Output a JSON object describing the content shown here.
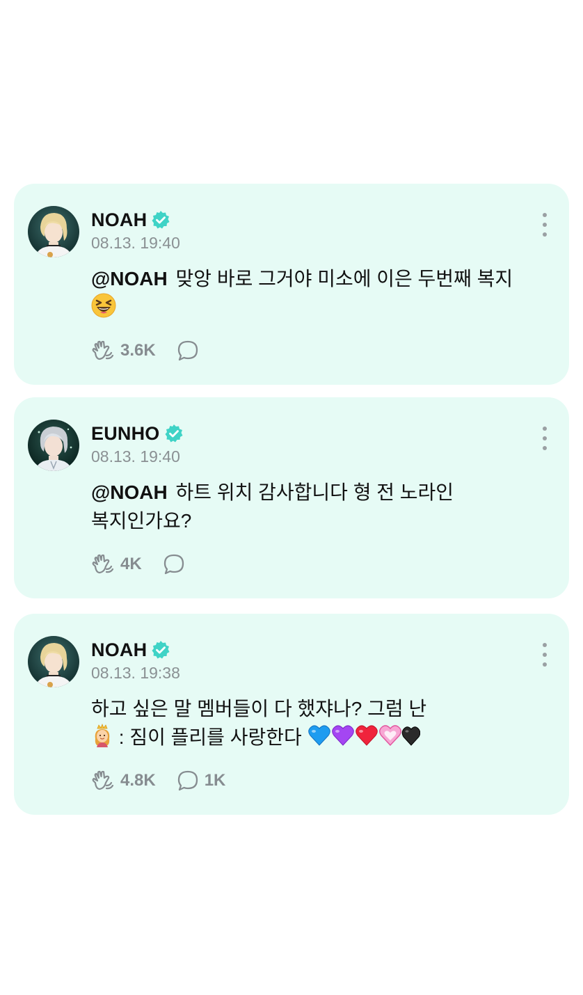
{
  "posts": [
    {
      "author": "NOAH",
      "timestamp": "08.13. 19:40",
      "mention": "@NOAH",
      "text": "맞앙 바로 그거야 미소에 이은 두번째 복지",
      "line2": "",
      "emoji": "grinning-squinting-face",
      "likes": "3.6K",
      "comments": ""
    },
    {
      "author": "EUNHO",
      "timestamp": "08.13. 19:40",
      "mention": "@NOAH",
      "text": "하트 위치 감사합니다 형 전 노라인",
      "line2": "복지인가요?",
      "likes": "4K",
      "comments": ""
    },
    {
      "author": "NOAH",
      "timestamp": "08.13. 19:38",
      "mention": "",
      "text": "하고 싶은 말 멤버들이 다 했쟈나? 그럼 난",
      "line2": " : 짐이 플리를 사랑한다 ",
      "likes": "4.8K",
      "comments": "1K"
    }
  ],
  "colors": {
    "card_background": "#e6fbf5",
    "verified_badge": "#3fd3c6",
    "meta_text": "#8a9093",
    "icon_gray": "#868c90"
  },
  "icons": {
    "like": "hand-wave-like-icon",
    "comment": "speech-bubble-icon",
    "verified": "verified-badge-icon",
    "more": "more-vertical-icon"
  }
}
